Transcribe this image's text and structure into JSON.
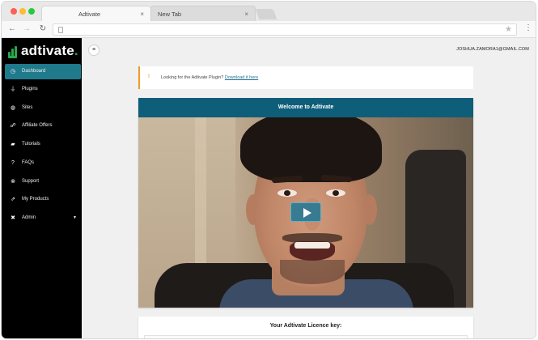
{
  "browser": {
    "tabs": [
      {
        "title": "Adtivate",
        "close": "×"
      },
      {
        "title": "New Tab",
        "close": "×"
      }
    ],
    "nav": {
      "back": "←",
      "forward": "→",
      "reload": "↻"
    },
    "address": "",
    "star": "★",
    "menu": "⋮"
  },
  "brand": {
    "logo_text": "adtivate",
    "logo_dot": ".",
    "accent": "#2aa84b"
  },
  "sidebar": {
    "items": [
      {
        "label": "Dashboard",
        "icon": "dashboard-icon",
        "glyph": "◷"
      },
      {
        "label": "Plugins",
        "icon": "plug-icon",
        "glyph": "⏚"
      },
      {
        "label": "Sites",
        "icon": "globe-icon",
        "glyph": "◍"
      },
      {
        "label": "Affiliate Offers",
        "icon": "sitemap-icon",
        "glyph": "☍"
      },
      {
        "label": "Tutorials",
        "icon": "graduation-cap-icon",
        "glyph": "▰"
      },
      {
        "label": "FAQs",
        "icon": "question-icon",
        "glyph": "?"
      },
      {
        "label": "Support",
        "icon": "support-icon",
        "glyph": "⊗"
      },
      {
        "label": "My Products",
        "icon": "external-link-icon",
        "glyph": "⇗"
      },
      {
        "label": "Admin",
        "icon": "tools-icon",
        "glyph": "✖",
        "caret": "▼"
      }
    ],
    "active_color": "#1f7a8c"
  },
  "header": {
    "menu_glyph": "≡",
    "user_email": "JOSHUA.ZAMORA1@GMAIL.COM"
  },
  "notice": {
    "glyph": "!",
    "text": "Looking for the Adtivate Plugin?",
    "link": "Download it here",
    "accent": "#f09a24"
  },
  "video_card": {
    "title": "Welcome to Adtivate",
    "header_color": "#0e5e79"
  },
  "licence": {
    "title": "Your Adtivate Licence key:",
    "value": ""
  }
}
